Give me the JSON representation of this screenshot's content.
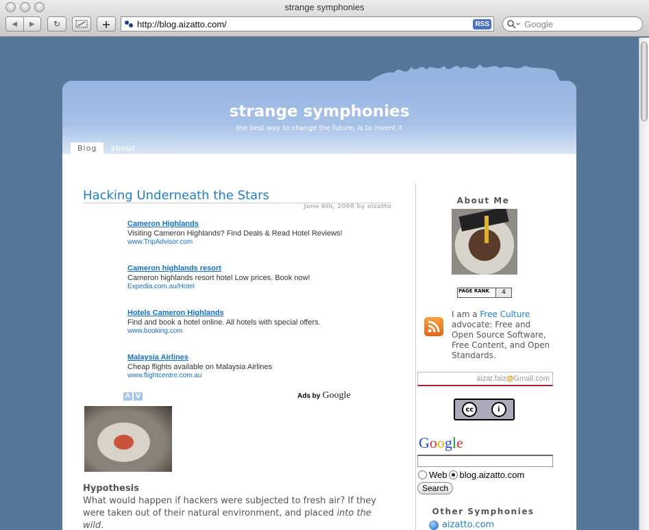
{
  "browser": {
    "window_title": "strange symphonies",
    "url": "http://blog.aizatto.com/",
    "rss_label": "RSS",
    "search_placeholder": "Google",
    "back_icon": "◀",
    "forward_icon": "▶",
    "reload_icon": "↻",
    "add_icon": "+"
  },
  "site": {
    "title": "strange symphonies",
    "tagline": "the best way to change the future, is to invent it",
    "nav": [
      "Blog",
      "about"
    ]
  },
  "post": {
    "title": "Hacking Underneath the Stars",
    "meta": "June 6th, 2008 by aizatto",
    "ads": [
      {
        "title": "Cameron Highlands",
        "desc": "Visiting Cameron Highlands? Find Deals & Read Hotel Reviews!",
        "url": "www.TripAdvisor.com"
      },
      {
        "title": "Cameron highlands resort",
        "desc": "Cameron highlands resort hotel Low prices. Book now!",
        "url": "Expedia.com.au/Hotel"
      },
      {
        "title": "Hotels Cameron Highlands",
        "desc": "Find and book a hotel online. All hotels with special offers.",
        "url": "www.booking.com"
      },
      {
        "title": "Malaysia Airlines",
        "desc": "Cheap flights available on Malaysia Airlines",
        "url": "www.flightcentre.com.au"
      }
    ],
    "ads_up": "Λ",
    "ads_down": "V",
    "ads_by": "Ads by",
    "ads_google": "Google",
    "hypothesis_heading": "Hypothesis",
    "hypothesis_body_1": "What would happen if hackers were subjected to fresh air? If they were taken out of their natural environment, and placed ",
    "hypothesis_body_em": "into the wild",
    "hypothesis_body_2": "."
  },
  "sidebar": {
    "about_heading": "About Me",
    "pagerank_label": "PAGE RANK",
    "pagerank_value": "4",
    "free_prefix": "I am a ",
    "free_link": "Free Culture",
    "free_suffix": " advocate: Free and Open Source Software, Free Content, and Open Standards.",
    "email_user": "aizat.faiz",
    "email_at": "@",
    "email_domain": "Gmail.com",
    "cc_left": "cc",
    "cc_right": "i",
    "google_search": {
      "radio_web": "Web",
      "radio_site": "blog.aizatto.com",
      "button": "Search"
    },
    "other_heading": "Other Symphonies",
    "other_links": [
      "aizatto.com"
    ]
  }
}
